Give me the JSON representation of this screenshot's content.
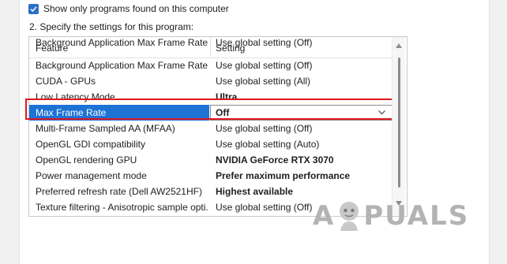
{
  "show_only_programs": {
    "label": "Show only programs found on this computer",
    "checked": true
  },
  "step_label": "2. Specify the settings for this program:",
  "columns": {
    "feature": "Feature",
    "setting": "Setting"
  },
  "rows": [
    {
      "feature": "Background Application Max Frame Rate",
      "setting": "Use global setting (Off)",
      "bold": false
    },
    {
      "feature": "CUDA - GPUs",
      "setting": "Use global setting (All)",
      "bold": false
    },
    {
      "feature": "Low Latency Mode",
      "setting": "Ultra",
      "bold": true
    },
    {
      "feature": "Max Frame Rate",
      "setting": "Off",
      "bold": true,
      "selected": true
    },
    {
      "feature": "Multi-Frame Sampled AA (MFAA)",
      "setting": "Use global setting (Off)",
      "bold": false
    },
    {
      "feature": "OpenGL GDI compatibility",
      "setting": "Use global setting (Auto)",
      "bold": false
    },
    {
      "feature": "OpenGL rendering GPU",
      "setting": "NVIDIA GeForce RTX 3070",
      "bold": true
    },
    {
      "feature": "Power management mode",
      "setting": "Prefer maximum performance",
      "bold": true
    },
    {
      "feature": "Preferred refresh rate (Dell AW2521HF)",
      "setting": "Highest available",
      "bold": true
    },
    {
      "feature": "Texture filtering - Anisotropic sample opti...",
      "setting": "Use global setting (Off)",
      "bold": false
    }
  ],
  "watermark": {
    "prefix": "A",
    "suffix": "PUALS"
  },
  "colors": {
    "selection": "#1c73d4",
    "highlight_border": "#e0171f",
    "checkbox": "#2c6fc7"
  }
}
